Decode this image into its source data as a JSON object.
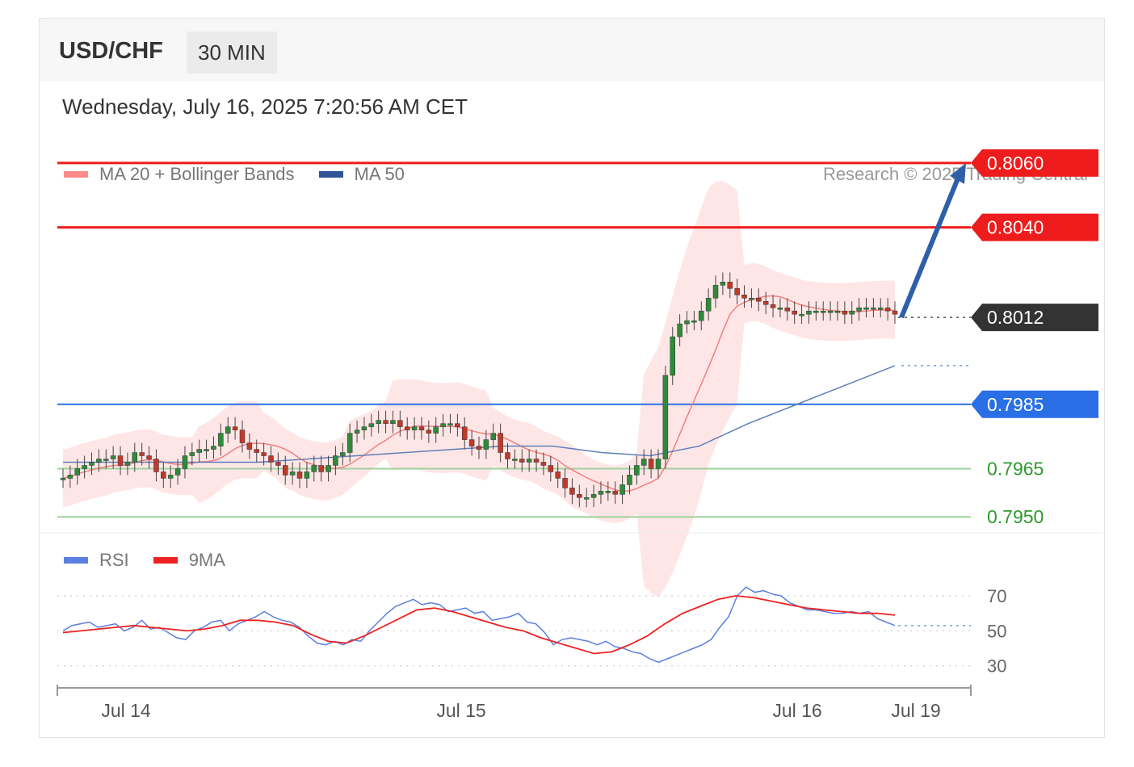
{
  "header": {
    "symbol": "USD/CHF",
    "timeframe": "30 MIN"
  },
  "datetime": "Wednesday, July 16, 2025 7:20:56 AM CET",
  "legend_main": [
    {
      "label": "MA 20 + Bollinger Bands",
      "color": "#ff8a8a"
    },
    {
      "label": "MA 50",
      "color": "#2f5597"
    }
  ],
  "legend_rsi": [
    {
      "label": "RSI",
      "color": "#5b7fe0"
    },
    {
      "label": "9MA",
      "color": "#ee2222"
    }
  ],
  "research": "Research © 2025 Trading Central",
  "colors": {
    "resistance": "#ee1c1c",
    "support_blue": "#2b6fe6",
    "support_green": "#9fd29f",
    "current": "#333333",
    "arrow": "#2f5fa8",
    "up": "#2e8b3a",
    "down": "#c0392b",
    "band": "#ffe2e2",
    "ma20": "#f08080",
    "ma50": "#5f7fb8"
  },
  "chart_data": [
    {
      "type": "candlestick",
      "title": "USD/CHF",
      "ylim": [
        0.7935,
        0.8068
      ],
      "x_ticks": [
        "Jul 14",
        "Jul 15",
        "Jul 16",
        "Jul 19"
      ],
      "levels": [
        {
          "value": 0.806,
          "label": "0.8060",
          "kind": "resistance"
        },
        {
          "value": 0.804,
          "label": "0.8040",
          "kind": "resistance"
        },
        {
          "value": 0.8012,
          "label": "0.8012",
          "kind": "current"
        },
        {
          "value": 0.7985,
          "label": "0.7985",
          "kind": "support"
        },
        {
          "value": 0.7965,
          "label": "0.7965",
          "kind": "minor"
        },
        {
          "value": 0.795,
          "label": "0.7950",
          "kind": "minor"
        }
      ],
      "close_path": [
        0.7962,
        0.7963,
        0.7965,
        0.7966,
        0.7967,
        0.7968,
        0.7968,
        0.7969,
        0.7966,
        0.7967,
        0.797,
        0.7969,
        0.7968,
        0.7964,
        0.7962,
        0.7963,
        0.7965,
        0.7969,
        0.797,
        0.7971,
        0.7971,
        0.7972,
        0.7976,
        0.7978,
        0.7977,
        0.7973,
        0.7971,
        0.797,
        0.7969,
        0.7967,
        0.7966,
        0.7963,
        0.7964,
        0.7962,
        0.7964,
        0.7966,
        0.7964,
        0.7966,
        0.7969,
        0.797,
        0.7976,
        0.7977,
        0.7978,
        0.7979,
        0.798,
        0.7979,
        0.798,
        0.7978,
        0.7977,
        0.7978,
        0.7977,
        0.7976,
        0.7978,
        0.7979,
        0.7979,
        0.7978,
        0.7974,
        0.7972,
        0.7971,
        0.7974,
        0.7976,
        0.797,
        0.7968,
        0.7968,
        0.7967,
        0.7968,
        0.7967,
        0.7966,
        0.7964,
        0.7962,
        0.7959,
        0.7957,
        0.7956,
        0.7956,
        0.7957,
        0.7958,
        0.7958,
        0.7957,
        0.796,
        0.7963,
        0.7966,
        0.7968,
        0.7965,
        0.7968,
        0.7994,
        0.8006,
        0.801,
        0.8011,
        0.8011,
        0.8014,
        0.8018,
        0.8022,
        0.8023,
        0.8021,
        0.8019,
        0.8018,
        0.8018,
        0.8017,
        0.8016,
        0.8015,
        0.8015,
        0.8014,
        0.8013,
        0.8013,
        0.8014,
        0.8014,
        0.8014,
        0.8014,
        0.8014,
        0.8013,
        0.8014,
        0.8015,
        0.8015,
        0.8015,
        0.8015,
        0.8014,
        0.8013
      ],
      "ma50_path": [
        0.7967,
        0.7967,
        0.7967,
        0.7967,
        0.7967,
        0.7968,
        0.7969,
        0.797,
        0.7971,
        0.7972,
        0.7972,
        0.797,
        0.7969,
        0.7972,
        0.7979,
        0.7985,
        0.7991,
        0.7997
      ],
      "projection": {
        "from": 0.8012,
        "to": 0.806
      }
    },
    {
      "type": "line",
      "title": "RSI",
      "ylim": [
        22,
        82
      ],
      "y_ticks": [
        "70",
        "50",
        "30"
      ],
      "series": [
        {
          "name": "RSI",
          "values": [
            50,
            53,
            54,
            55,
            52,
            53,
            54,
            50,
            52,
            56,
            51,
            52,
            49,
            46,
            45,
            50,
            52,
            55,
            56,
            50,
            54,
            56,
            58,
            61,
            58,
            56,
            55,
            52,
            47,
            43,
            42,
            44,
            42,
            45,
            44,
            50,
            55,
            60,
            64,
            66,
            68,
            65,
            66,
            65,
            61,
            62,
            63,
            60,
            61,
            56,
            57,
            58,
            60,
            55,
            54,
            49,
            42,
            45,
            46,
            45,
            44,
            42,
            44,
            41,
            40,
            38,
            37,
            34,
            32,
            34,
            36,
            38,
            40,
            42,
            45,
            52,
            58,
            70,
            75,
            72,
            73,
            71,
            70,
            66,
            64,
            62,
            62,
            61,
            60,
            60,
            61,
            60,
            61,
            57,
            55,
            53
          ]
        },
        {
          "name": "9MA",
          "values": [
            49,
            50,
            51,
            52,
            53,
            52,
            51,
            50,
            51,
            53,
            56,
            56,
            55,
            53,
            48,
            44,
            43,
            47,
            52,
            57,
            62,
            63,
            61,
            58,
            55,
            52,
            50,
            46,
            43,
            40,
            37,
            38,
            42,
            47,
            54,
            60,
            64,
            68,
            70,
            69,
            67,
            65,
            63,
            62,
            61,
            60,
            60,
            59
          ]
        }
      ]
    }
  ]
}
